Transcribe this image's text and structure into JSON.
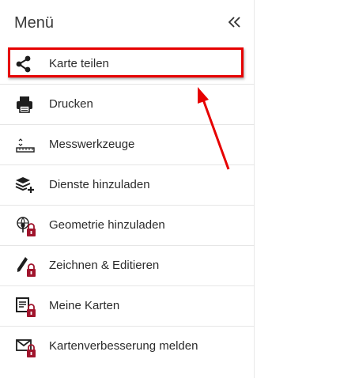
{
  "menu": {
    "title": "Menü",
    "collapse_icon": "double-chevron-left-icon",
    "items": [
      {
        "label": "Karte teilen",
        "icon": "share-icon",
        "locked": false,
        "highlighted": true
      },
      {
        "label": "Drucken",
        "icon": "printer-icon",
        "locked": false
      },
      {
        "label": "Messwerkzeuge",
        "icon": "ruler-icon",
        "locked": false
      },
      {
        "label": "Dienste hinzuladen",
        "icon": "layers-add-icon",
        "locked": false
      },
      {
        "label": "Geometrie hinzuladen",
        "icon": "geometry-icon",
        "locked": true
      },
      {
        "label": "Zeichnen & Editieren",
        "icon": "pencil-icon",
        "locked": true
      },
      {
        "label": "Meine Karten",
        "icon": "my-maps-icon",
        "locked": true
      },
      {
        "label": "Kartenverbesserung melden",
        "icon": "mail-icon",
        "locked": true
      }
    ]
  },
  "colors": {
    "highlight": "#e60000",
    "lock": "#a0142c",
    "icon": "#1e1e1e",
    "arrow": "#e60000"
  }
}
